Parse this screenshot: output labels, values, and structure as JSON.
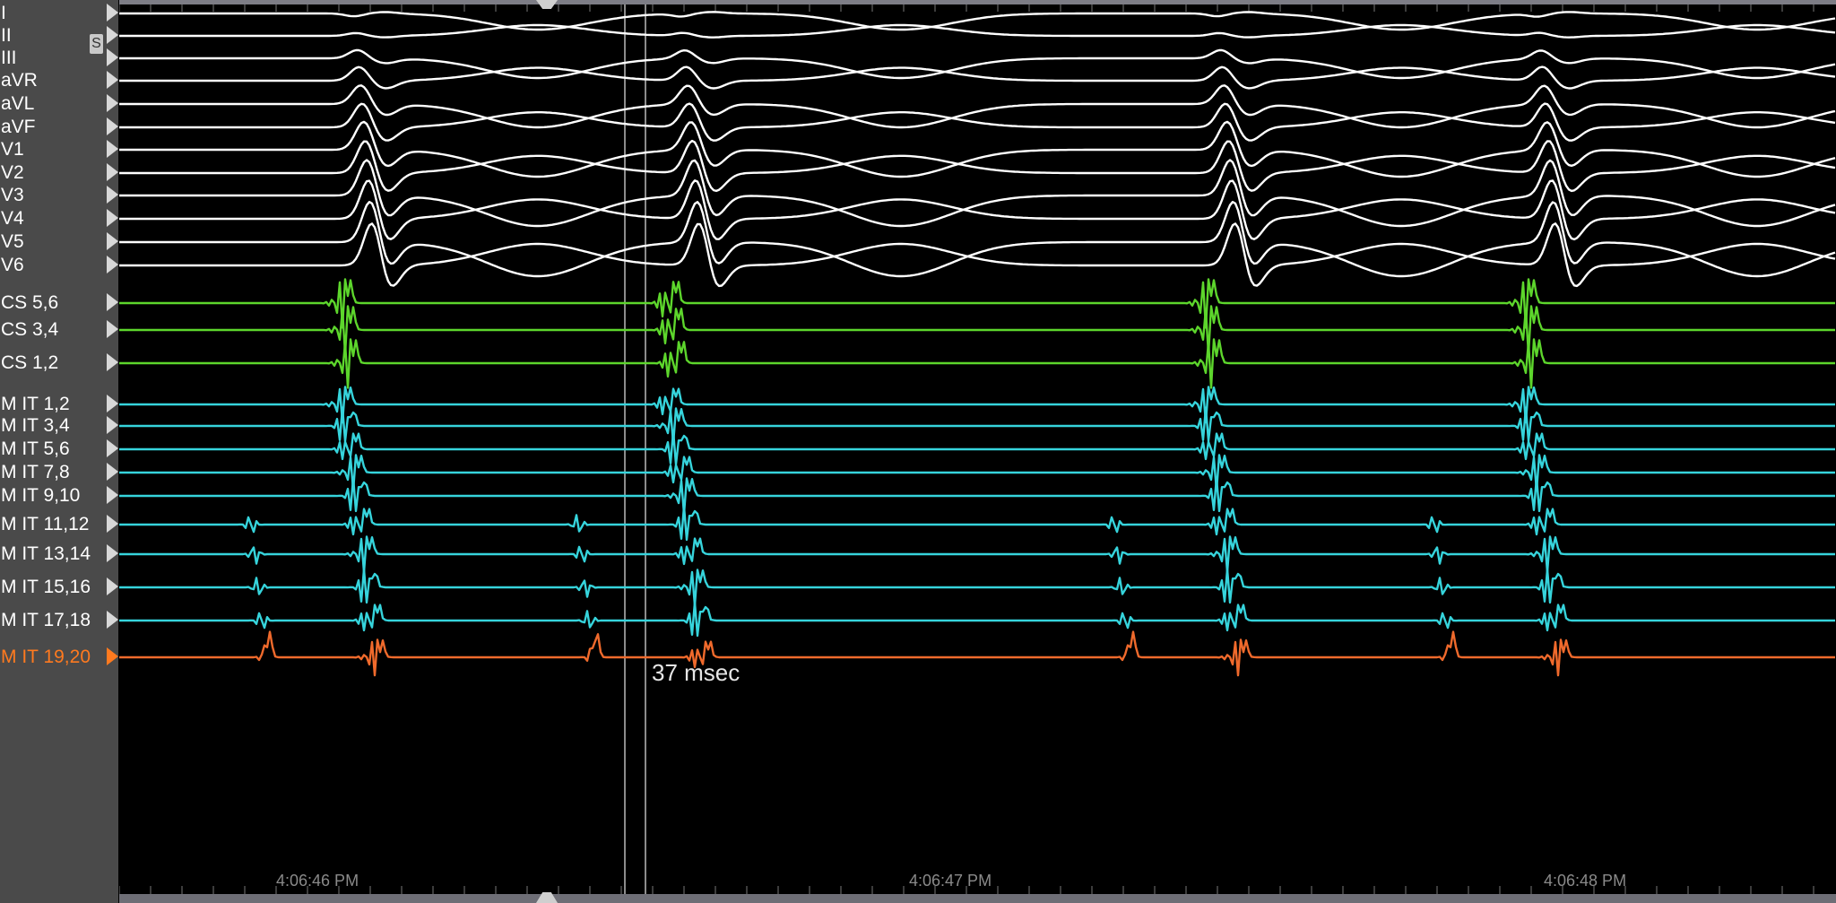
{
  "leads": [
    {
      "label": "I",
      "type": "ecg",
      "color": "#ffffff"
    },
    {
      "label": "II",
      "type": "ecg",
      "color": "#ffffff"
    },
    {
      "label": "III",
      "type": "ecg",
      "color": "#ffffff"
    },
    {
      "label": "aVR",
      "type": "ecg",
      "color": "#ffffff"
    },
    {
      "label": "aVL",
      "type": "ecg",
      "color": "#ffffff"
    },
    {
      "label": "aVF",
      "type": "ecg",
      "color": "#ffffff"
    },
    {
      "label": "V1",
      "type": "ecg",
      "color": "#ffffff"
    },
    {
      "label": "V2",
      "type": "ecg",
      "color": "#ffffff"
    },
    {
      "label": "V3",
      "type": "ecg",
      "color": "#ffffff"
    },
    {
      "label": "V4",
      "type": "ecg",
      "color": "#ffffff"
    },
    {
      "label": "V5",
      "type": "ecg",
      "color": "#ffffff"
    },
    {
      "label": "V6",
      "type": "ecg",
      "color": "#ffffff"
    },
    {
      "label": "CS 5,6",
      "type": "cs",
      "color": "#5dd62c"
    },
    {
      "label": "CS 3,4",
      "type": "cs",
      "color": "#5dd62c"
    },
    {
      "label": "CS 1,2",
      "type": "cs",
      "color": "#5dd62c"
    },
    {
      "label": "M IT 1,2",
      "type": "mit",
      "color": "#36d4dc"
    },
    {
      "label": "M IT 3,4",
      "type": "mit",
      "color": "#36d4dc"
    },
    {
      "label": "M IT 5,6",
      "type": "mit",
      "color": "#36d4dc"
    },
    {
      "label": "M IT 7,8",
      "type": "mit",
      "color": "#36d4dc"
    },
    {
      "label": "M IT 9,10",
      "type": "mit",
      "color": "#36d4dc"
    },
    {
      "label": "M IT 11,12",
      "type": "mit",
      "color": "#36d4dc"
    },
    {
      "label": "M IT 13,14",
      "type": "mit",
      "color": "#36d4dc"
    },
    {
      "label": "M IT 15,16",
      "type": "mit",
      "color": "#36d4dc"
    },
    {
      "label": "M IT 17,18",
      "type": "mit",
      "color": "#36d4dc"
    },
    {
      "label": "M IT 19,20",
      "type": "mit",
      "color": "#f06a2c",
      "active": true
    }
  ],
  "s_badge": "S",
  "measurement": {
    "label": "37 msec"
  },
  "time_labels": [
    "4:06:46 PM",
    "4:06:47 PM",
    "4:06:48 PM"
  ],
  "colors": {
    "background": "#000000",
    "sidebar": "#4a4a4a",
    "ecg": "#ffffff",
    "cs": "#5dd62c",
    "mit": "#36d4dc",
    "selected": "#f06a2c"
  }
}
